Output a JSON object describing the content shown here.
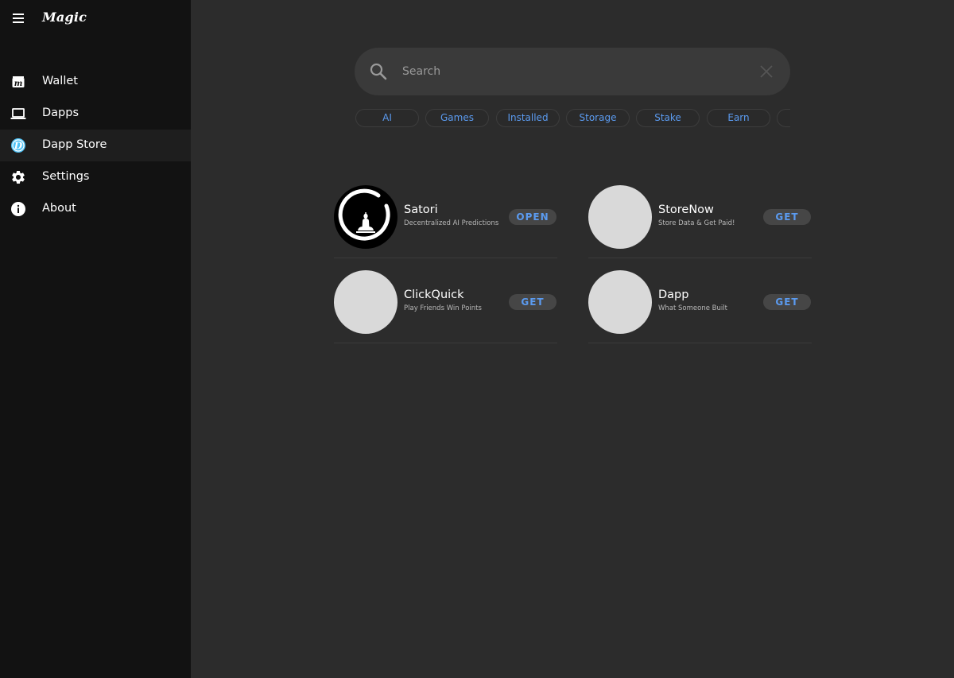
{
  "app": {
    "brand": "Magic"
  },
  "sidebar": {
    "items": [
      {
        "label": "Wallet",
        "icon": "wallet-icon",
        "active": false
      },
      {
        "label": "Dapps",
        "icon": "laptop-icon",
        "active": false
      },
      {
        "label": "Dapp Store",
        "icon": "dapp-store-icon",
        "active": true
      },
      {
        "label": "Settings",
        "icon": "gear-icon",
        "active": false
      },
      {
        "label": "About",
        "icon": "info-icon",
        "active": false
      }
    ]
  },
  "search": {
    "placeholder": "Search",
    "value": ""
  },
  "categories": [
    "AI",
    "Games",
    "Installed",
    "Storage",
    "Stake",
    "Earn",
    ""
  ],
  "apps": [
    {
      "name": "Satori",
      "description": "Decentralized AI Predictions",
      "action": "OPEN"
    },
    {
      "name": "StoreNow",
      "description": "Store Data & Get Paid!",
      "action": "GET"
    },
    {
      "name": "ClickQuick",
      "description": "Play Friends Win Points",
      "action": "GET"
    },
    {
      "name": "Dapp",
      "description": "What Someone Built",
      "action": "GET"
    }
  ],
  "colors": {
    "accent": "#5b9bf0",
    "sidebar_bg": "#121212",
    "main_bg": "#2c2c2c",
    "active_item_bg": "#1e1e1e",
    "dapp_store_icon": "#4fc3f7"
  }
}
